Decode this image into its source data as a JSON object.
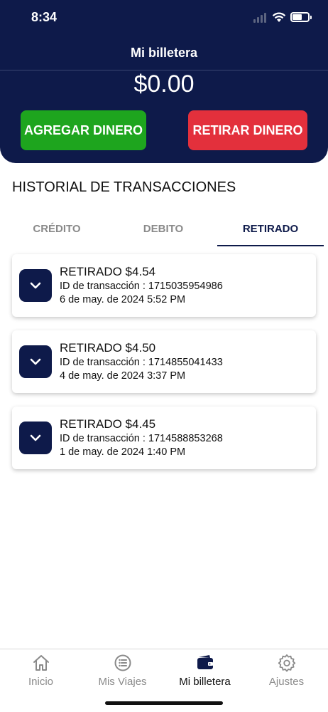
{
  "status_bar": {
    "time": "8:34"
  },
  "header": {
    "title": "Mi billetera",
    "balance": "$0.00",
    "add_money_label": "AGREGAR DINERO",
    "withdraw_money_label": "RETIRAR DINERO"
  },
  "history": {
    "title": "HISTORIAL DE TRANSACCIONES",
    "tabs": [
      {
        "label": "CRÉDITO",
        "active": false
      },
      {
        "label": "DEBITO",
        "active": false
      },
      {
        "label": "RETIRADO",
        "active": true
      }
    ],
    "transactions": [
      {
        "amount": "RETIRADO $4.54",
        "transaction_id": "ID de transacción : 1715035954986",
        "date": "6 de may. de 2024 5:52 PM"
      },
      {
        "amount": "RETIRADO $4.50",
        "transaction_id": "ID de transacción : 1714855041433",
        "date": "4 de may. de 2024 3:37 PM"
      },
      {
        "amount": "RETIRADO $4.45",
        "transaction_id": "ID de transacción : 1714588853268",
        "date": "1 de may. de 2024 1:40 PM"
      }
    ]
  },
  "tab_bar": {
    "items": [
      {
        "label": "Inicio",
        "icon": "home-icon",
        "active": false
      },
      {
        "label": "Mis Viajes",
        "icon": "list-icon",
        "active": false
      },
      {
        "label": "Mi billetera",
        "icon": "wallet-icon",
        "active": true
      },
      {
        "label": "Ajustes",
        "icon": "gear-icon",
        "active": false
      }
    ]
  },
  "colors": {
    "navy": "#0e1a4a",
    "green": "#1ea51e",
    "red": "#e3303c",
    "inactive_gray": "#8a8a8a"
  }
}
